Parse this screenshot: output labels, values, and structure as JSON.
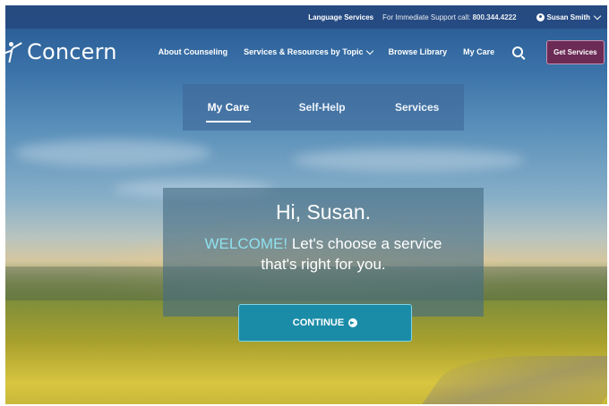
{
  "topbar": {
    "language_label": "Language Services",
    "support_prefix": "For Immediate Support call:",
    "support_phone": "800.344.4222",
    "user_name": "Susan Smith"
  },
  "brand": {
    "name": "Concern"
  },
  "nav": {
    "items": [
      "About Counseling",
      "Services & Resources by Topic",
      "Browse Library",
      "My Care"
    ],
    "cta": "Get Services"
  },
  "subnav": {
    "tabs": [
      "My Care",
      "Self-Help",
      "Services"
    ],
    "active": "My Care"
  },
  "welcome": {
    "greeting": "Hi, Susan.",
    "highlight": "WELCOME!",
    "message_line1": "Let's choose a service",
    "message_line2": "that's right for you.",
    "button": "CONTINUE"
  },
  "colors": {
    "topbar": "#264a80",
    "cta": "#6b2b55",
    "button": "#1b8ca8",
    "highlight": "#8fe0ef"
  },
  "icons": {
    "search": "search-icon",
    "user": "user-icon",
    "continue": "arrow-right-circle-icon"
  }
}
